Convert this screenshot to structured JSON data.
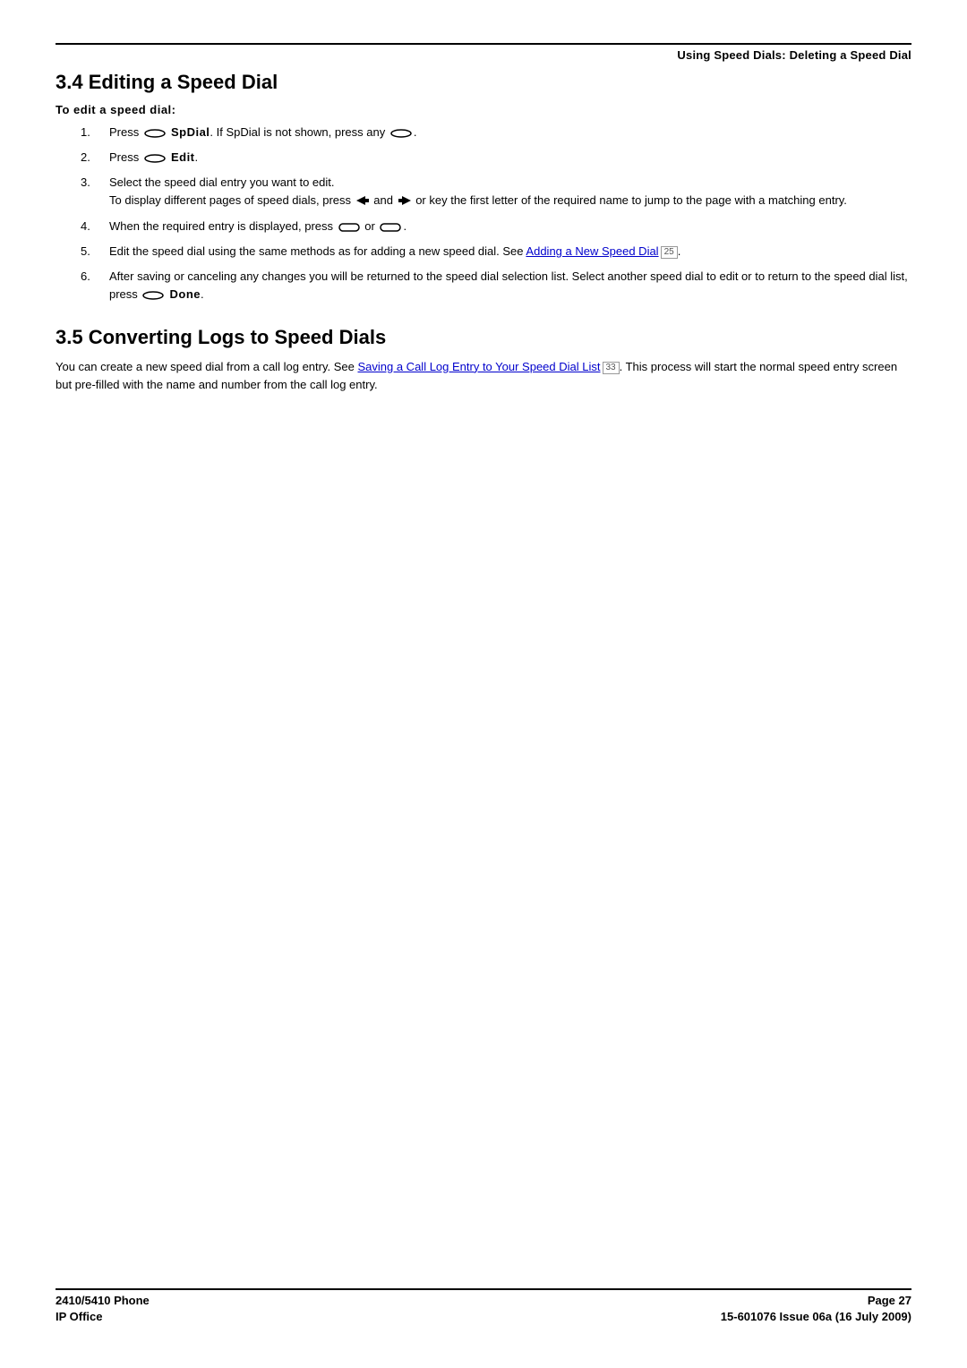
{
  "header": {
    "breadcrumb": "Using Speed Dials: Deleting a Speed Dial"
  },
  "section34": {
    "heading": "3.4 Editing a Speed Dial",
    "intro": "To edit a speed dial:",
    "steps": {
      "s1a": "Press ",
      "s1b": " SpDial",
      "s1c": ". If SpDial is not shown, press any ",
      "s1d": ".",
      "s2a": "Press ",
      "s2b": " Edit",
      "s2c": ".",
      "s3a": "Select the speed dial entry you want to edit.",
      "s3b": "To display different pages of speed dials, press ",
      "s3c": " and ",
      "s3d": " or key the first letter of the required name to jump to the page with a matching entry.",
      "s4a": "When the required entry is displayed, press ",
      "s4b": " or ",
      "s4c": ".",
      "s5a": "Edit the speed dial using the same methods as for adding a new speed dial. See ",
      "s5link": "Adding a New Speed Dial",
      "s5ref": "25",
      "s5b": ".",
      "s6a": "After saving or canceling any changes you will be returned to the speed dial selection list. Select another speed dial to edit or to return to the speed dial list, press ",
      "s6b": " Done",
      "s6c": "."
    }
  },
  "section35": {
    "heading": "3.5 Converting Logs to Speed Dials",
    "body_a": "You can create a new speed dial from a call log entry. See ",
    "link": "Saving a Call Log Entry to Your Speed Dial List",
    "ref": "33",
    "body_b": ". This process will start the normal speed entry screen but pre-filled with the name and number from the call log entry."
  },
  "footer": {
    "left1": "2410/5410 Phone",
    "left2": "IP Office",
    "right1": "Page 27",
    "right2": "15-601076 Issue 06a (16 July 2009)"
  }
}
